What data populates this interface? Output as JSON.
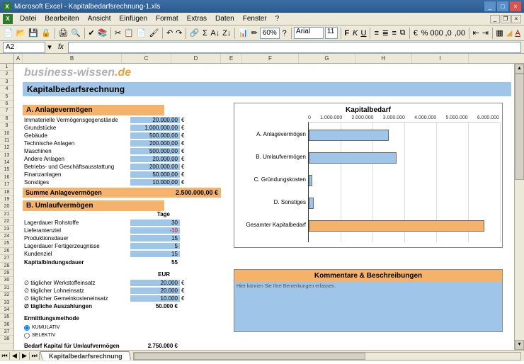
{
  "app": {
    "title": "Microsoft Excel - Kapitalbedarfsrechnung-1.xls"
  },
  "menu": [
    "Datei",
    "Bearbeiten",
    "Ansicht",
    "Einfügen",
    "Format",
    "Extras",
    "Daten",
    "Fenster",
    "?"
  ],
  "toolbar": {
    "zoom": "60%",
    "font": "Arial",
    "size": "11"
  },
  "namebox": "A2",
  "cols": [
    "A",
    "B",
    "C",
    "D",
    "E",
    "F",
    "G",
    "H",
    "I"
  ],
  "brand": {
    "text": "business-wissen",
    "tld": ".de"
  },
  "doc": {
    "title": "Kapitalbedarfsrechnung",
    "sectA": "A. Anlagevermögen",
    "sectB": "B. Umlaufvermögen",
    "rowsA": [
      {
        "lbl": "Immaterielle Vermögensgegenstände",
        "val": "20.000,00",
        "unit": "€"
      },
      {
        "lbl": "Grundstücke",
        "val": "1.000.000,00",
        "unit": "€"
      },
      {
        "lbl": "Gebäude",
        "val": "500.000,00",
        "unit": "€"
      },
      {
        "lbl": "Technische Anlagen",
        "val": "200.000,00",
        "unit": "€"
      },
      {
        "lbl": "Maschinen",
        "val": "500.000,00",
        "unit": "€"
      },
      {
        "lbl": "Andere Anlagen",
        "val": "20.000,00",
        "unit": "€"
      },
      {
        "lbl": "Betriebs- und Geschäftsausstattung",
        "val": "200.000,00",
        "unit": "€"
      },
      {
        "lbl": "Finanzanlagen",
        "val": "50.000,00",
        "unit": "€"
      },
      {
        "lbl": "Sonstiges",
        "val": "10.000,00",
        "unit": "€"
      }
    ],
    "sumA": {
      "lbl": "Summe Anlagevermögen",
      "val": "2.500.000,00 €"
    },
    "tageHdr": "Tage",
    "rowsB1": [
      {
        "lbl": "Lagerdauer Rohstoffe",
        "val": "30"
      },
      {
        "lbl": "Lieferantenziel",
        "val": "-10",
        "neg": true
      },
      {
        "lbl": "Produktionsdauer",
        "val": "15"
      },
      {
        "lbl": "Lagerdauer Fertigerzeugnisse",
        "val": "5"
      },
      {
        "lbl": "Kundenziel",
        "val": "15"
      }
    ],
    "bindung": {
      "lbl": "Kapitalbindungsdauer",
      "val": "55"
    },
    "eurHdr": "EUR",
    "rowsB2": [
      {
        "lbl": "∅ täglicher Werkstoffeinsatz",
        "val": "20.000",
        "unit": "€"
      },
      {
        "lbl": "∅ täglicher Lohneinsatz",
        "val": "20.000",
        "unit": "€"
      },
      {
        "lbl": "∅ täglicher Gemeinkosteneinsatz",
        "val": "10.000",
        "unit": "€"
      }
    ],
    "ausz": {
      "lbl": "∅ tägliche Auszahlungen",
      "val": "50.000 €"
    },
    "methode": "Ermittlungsmethode",
    "radio": [
      {
        "lbl": "KUMULATIV",
        "checked": true
      },
      {
        "lbl": "SELEKTIV",
        "checked": false
      }
    ],
    "bedarfUmlauf": {
      "lbl": "Bedarf Kapital für Umlaufvermögen",
      "val": "2.750.000 €"
    }
  },
  "chart_data": {
    "type": "bar",
    "title": "Kapitalbedarf",
    "xlim": [
      0,
      6000000
    ],
    "ticks": [
      "0",
      "1.000.000",
      "2.000.000",
      "3.000.000",
      "4.000.000",
      "5.000.000",
      "6.000.000"
    ],
    "series": [
      {
        "name": "A. Anlagevermögen",
        "value": 2500000
      },
      {
        "name": "B. Umlaufvermögen",
        "value": 2750000
      },
      {
        "name": "C. Gründungskosten",
        "value": 100000
      },
      {
        "name": "D. Sonstiges",
        "value": 150000
      },
      {
        "name": "Gesamter Kapitalbedarf",
        "value": 5500000
      }
    ]
  },
  "comments": {
    "title": "Kommentare & Beschreibungen",
    "placeholder": "Hier können Sie Ihre Bemerkungen erfassen."
  },
  "tabs": {
    "active": "Kapitalbedarfsrechnung"
  }
}
